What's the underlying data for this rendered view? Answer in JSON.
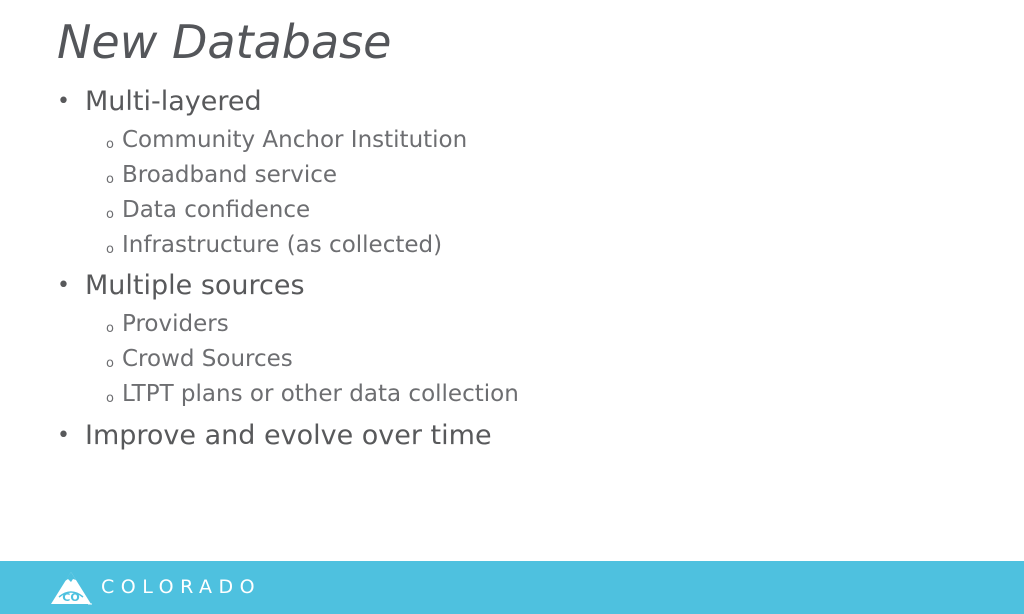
{
  "slide": {
    "title": "New Database",
    "bullets": [
      {
        "text": "Multi-layered",
        "sub": [
          "Community Anchor Institution",
          "Broadband service",
          "Data confidence",
          "Infrastructure (as collected)"
        ]
      },
      {
        "text": "Multiple sources",
        "sub": [
          "Providers",
          "Crowd Sources",
          "LTPT plans or other data collection"
        ]
      },
      {
        "text": "Improve and evolve over time",
        "sub": []
      }
    ],
    "bullet_glyph": "•",
    "sub_bullet_glyph": "o"
  },
  "footer": {
    "brand": "COLORADO",
    "logo_mark": "CO",
    "background_color": "#4ec1df"
  }
}
